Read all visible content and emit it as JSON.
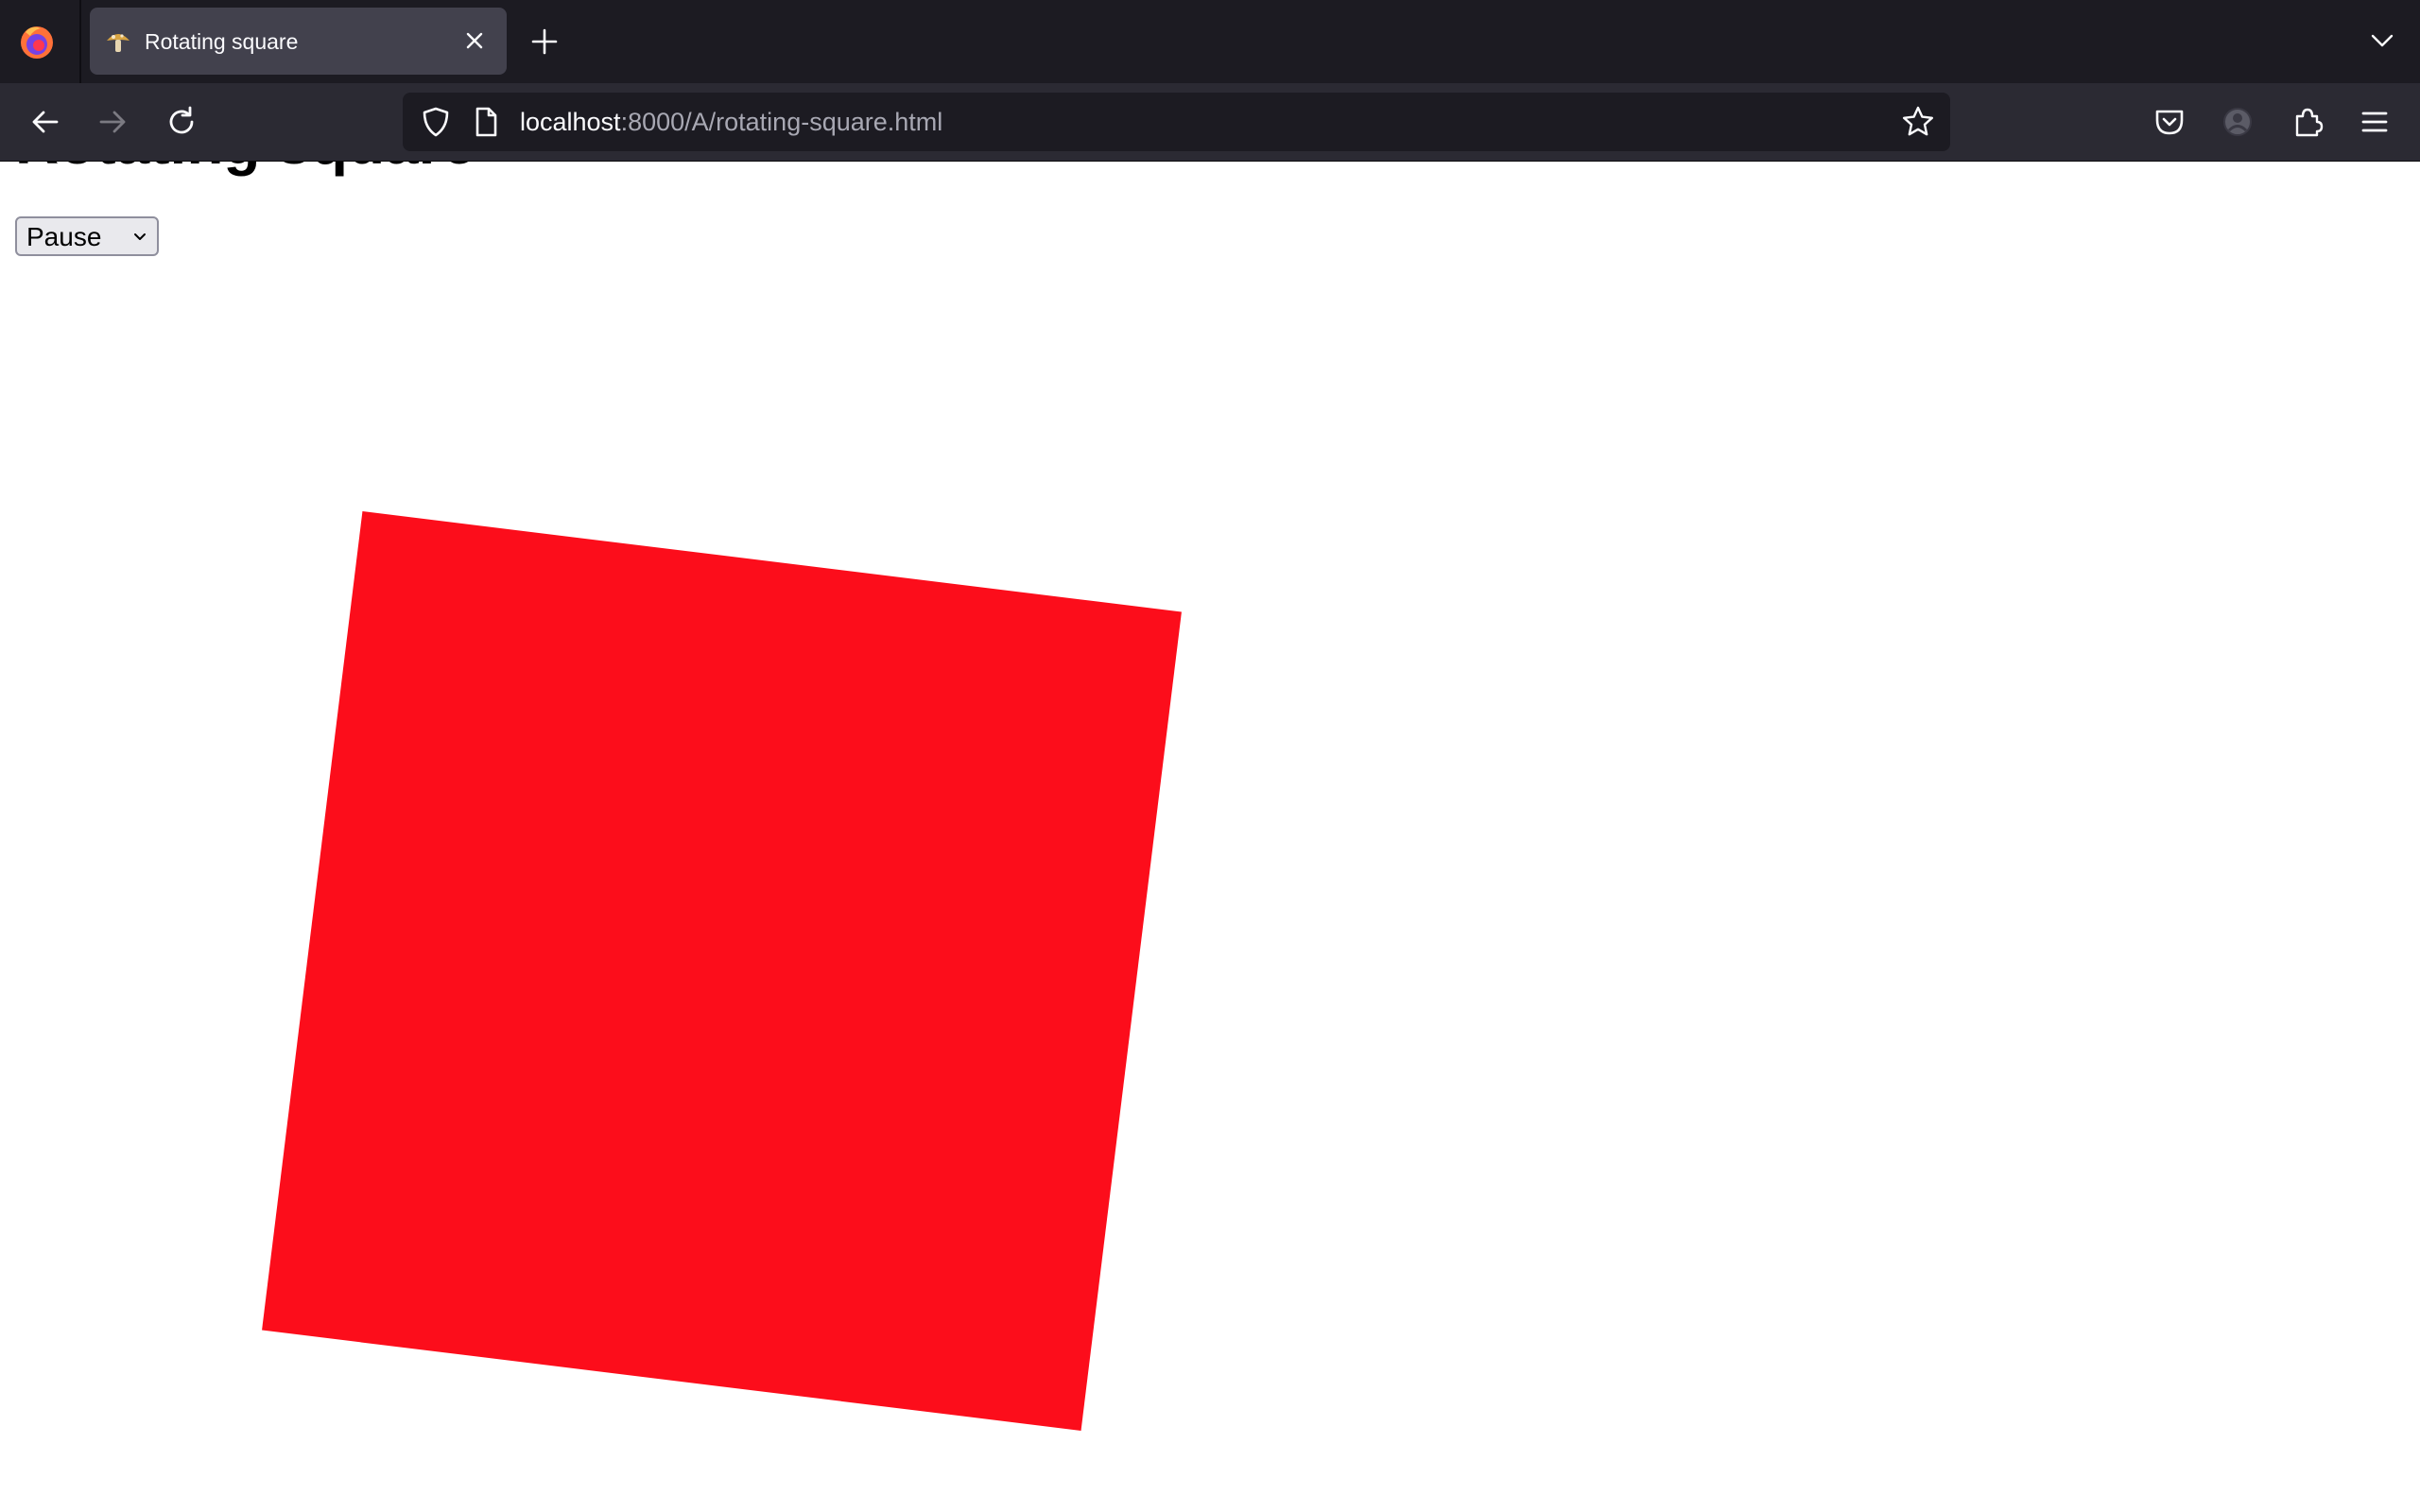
{
  "browser": {
    "tab": {
      "title": "Rotating square",
      "favicon": "mushroom-favicon-icon"
    },
    "url": {
      "host": "localhost",
      "rest": ":8000/A/rotating-square.html"
    }
  },
  "page": {
    "heading": "Rotating square",
    "control": {
      "selected": "Pause"
    },
    "square": {
      "color": "#fc0d1b",
      "rotation_deg": 7
    }
  }
}
